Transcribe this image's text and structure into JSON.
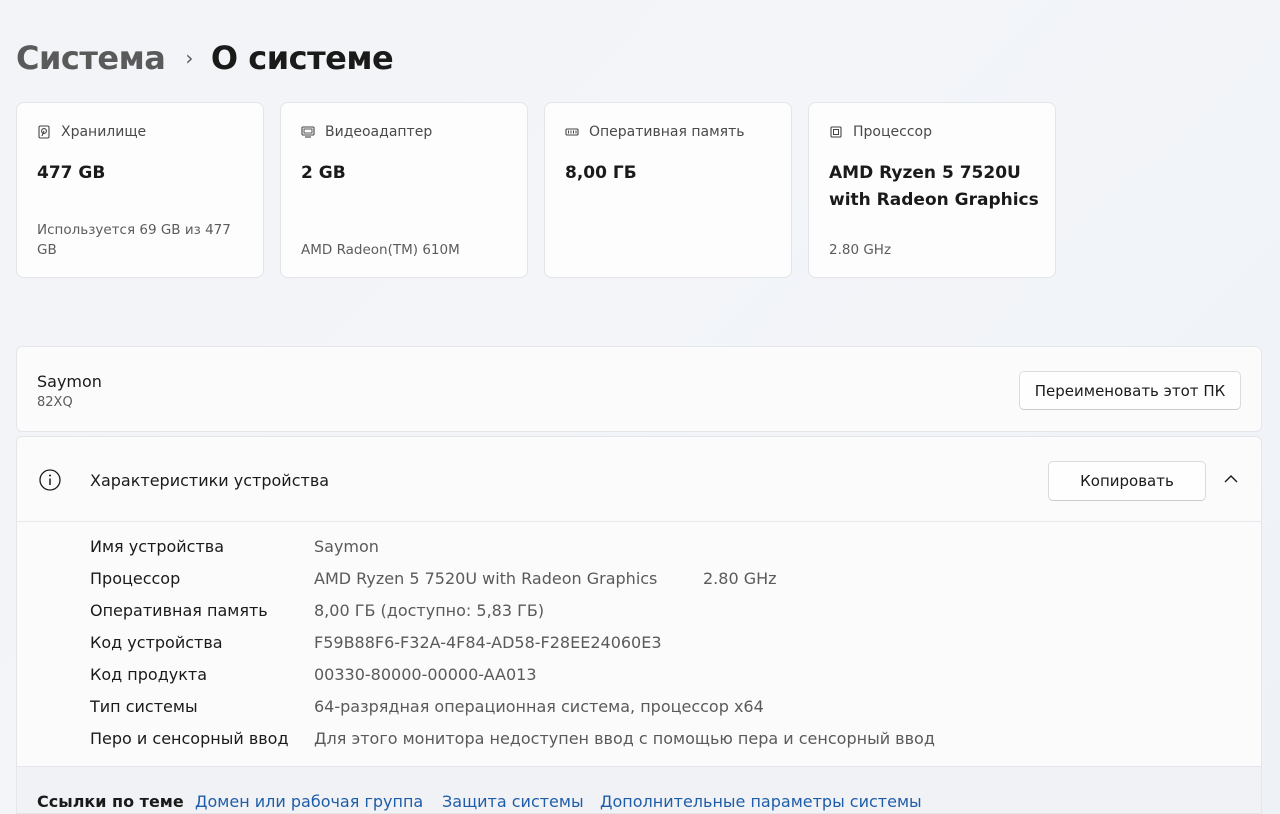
{
  "breadcrumb": {
    "parent": "Система",
    "separator": "›",
    "current": "О системе"
  },
  "cards": [
    {
      "id": "storage",
      "icon": "storage-icon",
      "title": "Хранилище",
      "value": "477 GB",
      "sub": "Используется 69 GB из 477 GB"
    },
    {
      "id": "gpu",
      "icon": "display-adapter-icon",
      "title": "Видеоадаптер",
      "value": "2 GB",
      "sub": "AMD Radeon(TM) 610M"
    },
    {
      "id": "ram",
      "icon": "memory-icon",
      "title": "Оперативная память",
      "value": "8,00 ГБ",
      "sub": ""
    },
    {
      "id": "cpu",
      "icon": "processor-icon",
      "title": "Процессор",
      "value": "AMD Ryzen 5 7520U with Radeon Graphics",
      "sub": "2.80 GHz"
    }
  ],
  "pc": {
    "name": "Saymon",
    "model": "82XQ",
    "rename_label": "Переименовать этот ПК"
  },
  "specs": {
    "title": "Характеристики устройства",
    "copy_label": "Копировать",
    "rows": [
      {
        "label": "Имя устройства",
        "value": "Saymon"
      },
      {
        "label": "Процессор",
        "value": "AMD Ryzen 5 7520U with Radeon Graphics",
        "extra": "2.80 GHz"
      },
      {
        "label": "Оперативная память",
        "value": "8,00 ГБ (доступно: 5,83 ГБ)"
      },
      {
        "label": "Код устройства",
        "value": "F59B88F6-F32A-4F84-AD58-F28EE24060E3"
      },
      {
        "label": "Код продукта",
        "value": "00330-80000-00000-AA013"
      },
      {
        "label": "Тип системы",
        "value": "64-разрядная операционная система, процессор x64"
      },
      {
        "label": "Перо и сенсорный ввод",
        "value": "Для этого монитора недоступен ввод с помощью пера и сенсорный ввод"
      }
    ]
  },
  "related": {
    "title": "Ссылки по теме",
    "links": [
      "Домен или рабочая группа",
      "Защита системы",
      "Дополнительные параметры системы"
    ]
  },
  "colors": {
    "link": "#1f5da8",
    "background": "#f2f4f8",
    "card": "#fdfdfe"
  }
}
